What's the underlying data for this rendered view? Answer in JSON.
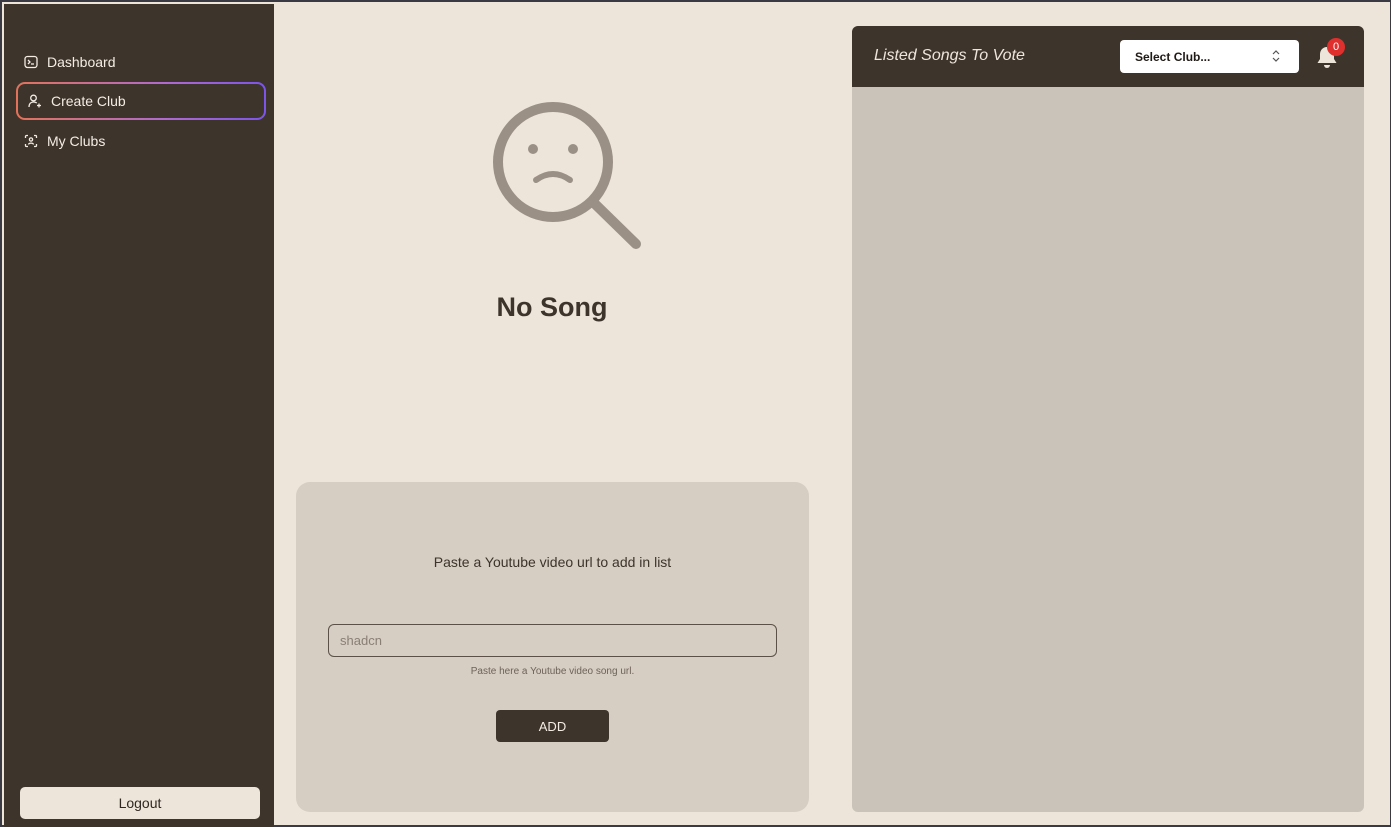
{
  "sidebar": {
    "items": [
      {
        "label": "Dashboard",
        "icon": "terminal-icon"
      },
      {
        "label": "Create Club",
        "icon": "user-plus-icon",
        "active": true
      },
      {
        "label": "My Clubs",
        "icon": "clubs-icon"
      }
    ],
    "logout_label": "Logout"
  },
  "empty_state": {
    "icon": "sad-magnifier-icon",
    "title": "No Song"
  },
  "add_song": {
    "title": "Paste a Youtube video url to add in list",
    "input_placeholder": "shadcn",
    "input_value": "",
    "hint": "Paste here a Youtube video song url.",
    "button_label": "ADD"
  },
  "vote_panel": {
    "title": "Listed Songs To Vote",
    "select_label": "Select Club...",
    "notification_count": "0"
  },
  "colors": {
    "sidebar_bg": "#3d342b",
    "page_bg": "#ede5da",
    "card_bg": "#d6cdc3",
    "panel_bg": "#cac3b9",
    "badge": "#e0302d"
  }
}
